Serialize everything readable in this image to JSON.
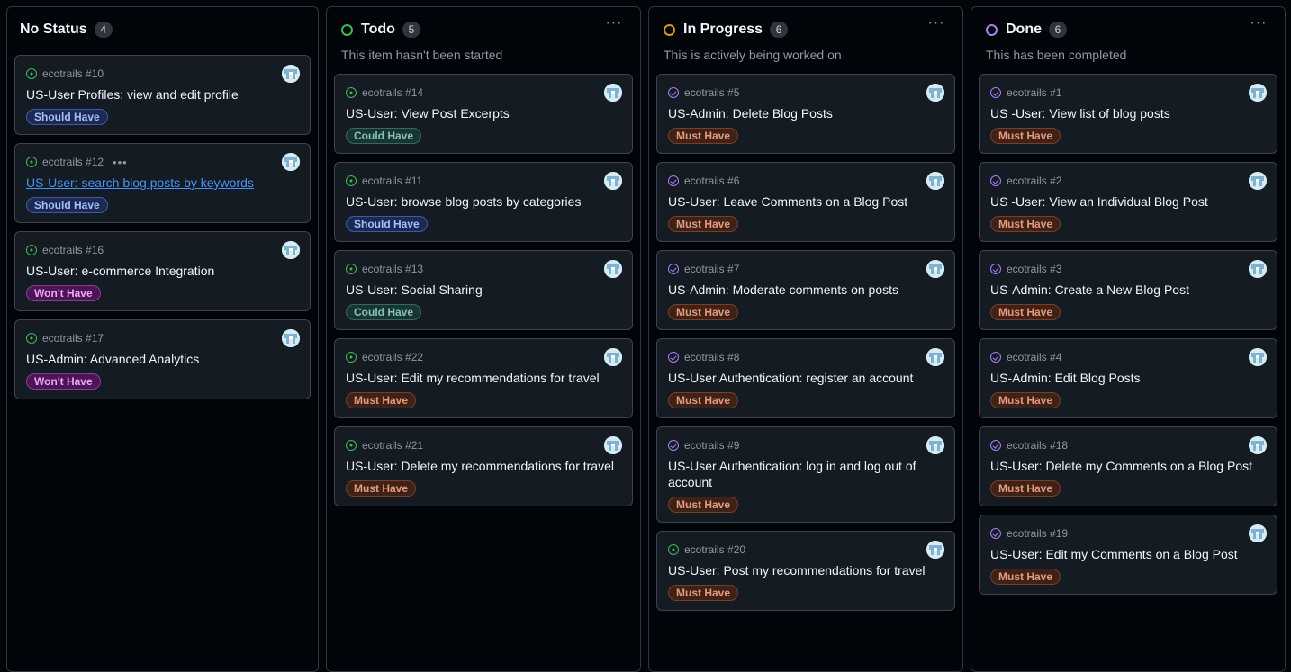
{
  "columns": [
    {
      "title": "No Status",
      "count": "4",
      "description": "",
      "ring_color": "",
      "cards": [
        {
          "ref": "ecotrails #10",
          "state": "open",
          "title": "US-User Profiles: view and edit profile",
          "label": "Should Have",
          "label_kind": "should"
        },
        {
          "ref": "ecotrails #12",
          "state": "open",
          "title": "US-User: search blog posts by keywords",
          "label": "Should Have",
          "label_kind": "should",
          "link": true,
          "more": "•••"
        },
        {
          "ref": "ecotrails #16",
          "state": "open",
          "title": "US-User: e-commerce Integration",
          "label": "Won't Have",
          "label_kind": "wont"
        },
        {
          "ref": "ecotrails #17",
          "state": "open",
          "title": "US-Admin: Advanced Analytics",
          "label": "Won't Have",
          "label_kind": "wont"
        }
      ]
    },
    {
      "title": "Todo",
      "count": "5",
      "description": "This item hasn't been started",
      "ring_color": "#3fb950",
      "cards": [
        {
          "ref": "ecotrails #14",
          "state": "open",
          "title": "US-User: View Post Excerpts",
          "label": "Could Have",
          "label_kind": "could"
        },
        {
          "ref": "ecotrails #11",
          "state": "open",
          "title": "US-User: browse blog posts by categories",
          "label": "Should Have",
          "label_kind": "should"
        },
        {
          "ref": "ecotrails #13",
          "state": "open",
          "title": "US-User: Social Sharing",
          "label": "Could Have",
          "label_kind": "could"
        },
        {
          "ref": "ecotrails #22",
          "state": "open",
          "title": "US-User: Edit my recommendations for travel",
          "label": "Must Have",
          "label_kind": "must"
        },
        {
          "ref": "ecotrails #21",
          "state": "open",
          "title": "US-User: Delete my recommendations for travel",
          "label": "Must Have",
          "label_kind": "must"
        }
      ]
    },
    {
      "title": "In Progress",
      "count": "6",
      "description": "This is actively being worked on",
      "ring_color": "#d29922",
      "cards": [
        {
          "ref": "ecotrails #5",
          "state": "closed",
          "title": "US-Admin: Delete Blog Posts",
          "label": "Must Have",
          "label_kind": "must"
        },
        {
          "ref": "ecotrails #6",
          "state": "closed",
          "title": "US-User: Leave Comments on a Blog Post",
          "label": "Must Have",
          "label_kind": "must"
        },
        {
          "ref": "ecotrails #7",
          "state": "closed",
          "title": "US-Admin: Moderate comments on posts",
          "label": "Must Have",
          "label_kind": "must"
        },
        {
          "ref": "ecotrails #8",
          "state": "closed",
          "title": "US-User Authentication: register an account",
          "label": "Must Have",
          "label_kind": "must"
        },
        {
          "ref": "ecotrails #9",
          "state": "closed",
          "title": "US-User Authentication: log in and log out of account",
          "label": "Must Have",
          "label_kind": "must"
        },
        {
          "ref": "ecotrails #20",
          "state": "open",
          "title": "US-User: Post my recommendations for travel",
          "label": "Must Have",
          "label_kind": "must"
        }
      ]
    },
    {
      "title": "Done",
      "count": "6",
      "description": "This has been completed",
      "ring_color": "#ab7df8",
      "cards": [
        {
          "ref": "ecotrails #1",
          "state": "closed",
          "title": "US -User: View list of blog posts",
          "label": "Must Have",
          "label_kind": "must"
        },
        {
          "ref": "ecotrails #2",
          "state": "closed",
          "title": "US -User: View an Individual Blog Post",
          "label": "Must Have",
          "label_kind": "must"
        },
        {
          "ref": "ecotrails #3",
          "state": "closed",
          "title": "US-Admin: Create a New Blog Post",
          "label": "Must Have",
          "label_kind": "must"
        },
        {
          "ref": "ecotrails #4",
          "state": "closed",
          "title": "US-Admin: Edit Blog Posts",
          "label": "Must Have",
          "label_kind": "must"
        },
        {
          "ref": "ecotrails #18",
          "state": "closed",
          "title": "US-User: Delete my Comments on a Blog Post",
          "label": "Must Have",
          "label_kind": "must"
        },
        {
          "ref": "ecotrails #19",
          "state": "closed",
          "title": "US-User: Edit my Comments on a Blog Post",
          "label": "Must Have",
          "label_kind": "must"
        }
      ]
    }
  ],
  "column_menu_glyph": "···"
}
